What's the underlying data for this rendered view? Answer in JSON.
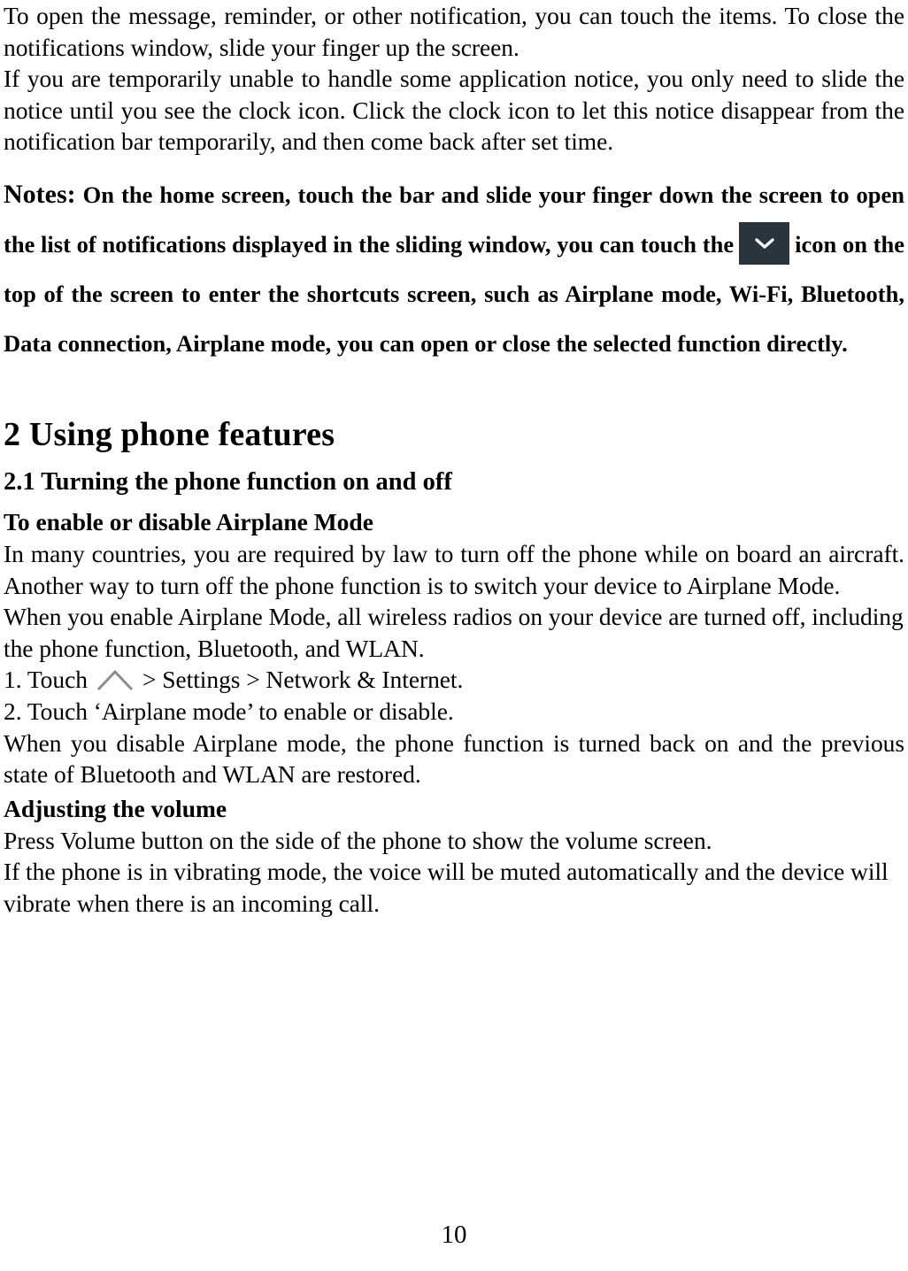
{
  "document": {
    "page_number": "10",
    "icon_color": "#2a343d",
    "icon_glyph_color": "#ffffff",
    "caret_icon_color": "#8a8a8a"
  },
  "intro": {
    "paragraph_1": "To open the message, reminder, or other notification, you can touch the items. To close the notifications window, slide your finger up the screen.",
    "paragraph_2": "If you are temporarily unable to handle some application notice, you only need to slide the notice until you see the clock icon. Click the clock icon to let this notice disappear from the notification bar temporarily, and then come back after set time."
  },
  "notes": {
    "label": "Notes:",
    "text_before_icon": "On the home screen, touch the bar and slide your finger down the screen to open the list of notifications displayed in the sliding window, you can touch the",
    "icon_name": "chevron-down-icon",
    "text_after_icon": "icon on the top of the screen to enter the shortcuts screen, such as Airplane mode, Wi-Fi, Bluetooth, Data connection, Airplane mode, you can open or close the selected function directly."
  },
  "chapter": {
    "title": "2 Using phone features",
    "section_title": "2.1 Turning the phone function on and off",
    "sub_heading_1": "To enable or disable Airplane Mode",
    "paragraph_1": "In many countries, you are required by law to turn off the phone while on board an aircraft. Another way to turn off the phone function is to switch your device to Airplane Mode.",
    "paragraph_2": "When you enable Airplane Mode, all wireless radios on your device are turned off, including the phone function, Bluetooth, and WLAN.",
    "step_1_before_icon": "1. Touch",
    "step_1_icon_name": "caret-up-icon",
    "step_1_after_icon": "> Settings > Network & Internet.",
    "step_2": "2. Touch ‘Airplane mode’ to enable or disable.",
    "paragraph_3": "When you disable Airplane mode, the phone function is turned back on and the previous state of Bluetooth and WLAN are restored.",
    "sub_heading_2": "Adjusting the volume",
    "paragraph_4": "Press Volume button on the side of the phone to show the volume screen.",
    "paragraph_5": "If the phone is in vibrating mode, the voice will be muted automatically and the device will vibrate when there is an incoming call."
  }
}
